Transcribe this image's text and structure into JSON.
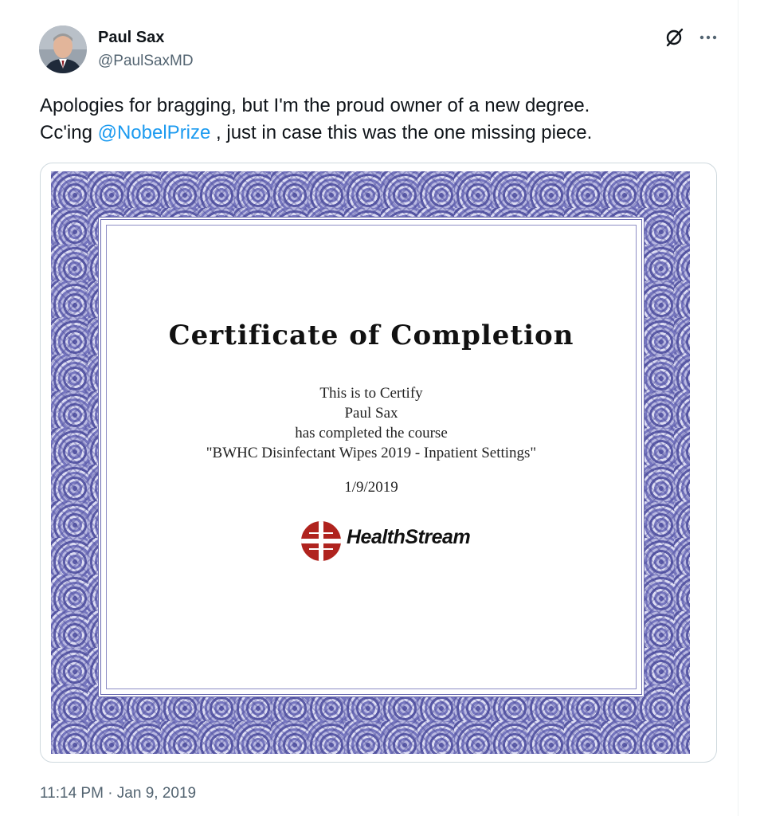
{
  "tweet": {
    "author": {
      "display_name": "Paul Sax",
      "handle": "@PaulSaxMD"
    },
    "text_line1": "Apologies for bragging, but I'm the proud owner of a new degree.",
    "text_line2_prefix": "Cc'ing ",
    "mention": "@NobelPrize",
    "text_line2_suffix": " , just in case this was the one missing piece.",
    "timestamp": "11:14 PM · Jan 9, 2019",
    "icons": {
      "grok": "grok-icon",
      "more": "more-icon"
    }
  },
  "certificate": {
    "title": "Certificate of Completion",
    "line1": "This is to Certify",
    "recipient": "Paul Sax",
    "line3": "has completed the course",
    "course": "\"BWHC Disinfectant Wipes 2019 - Inpatient Settings\"",
    "date": "1/9/2019",
    "logo_text": "HealthStream"
  },
  "colors": {
    "link": "#1d9bf0",
    "secondary_text": "#536471",
    "border_purple": "#5c5ca8",
    "logo_red": "#b0231e"
  }
}
